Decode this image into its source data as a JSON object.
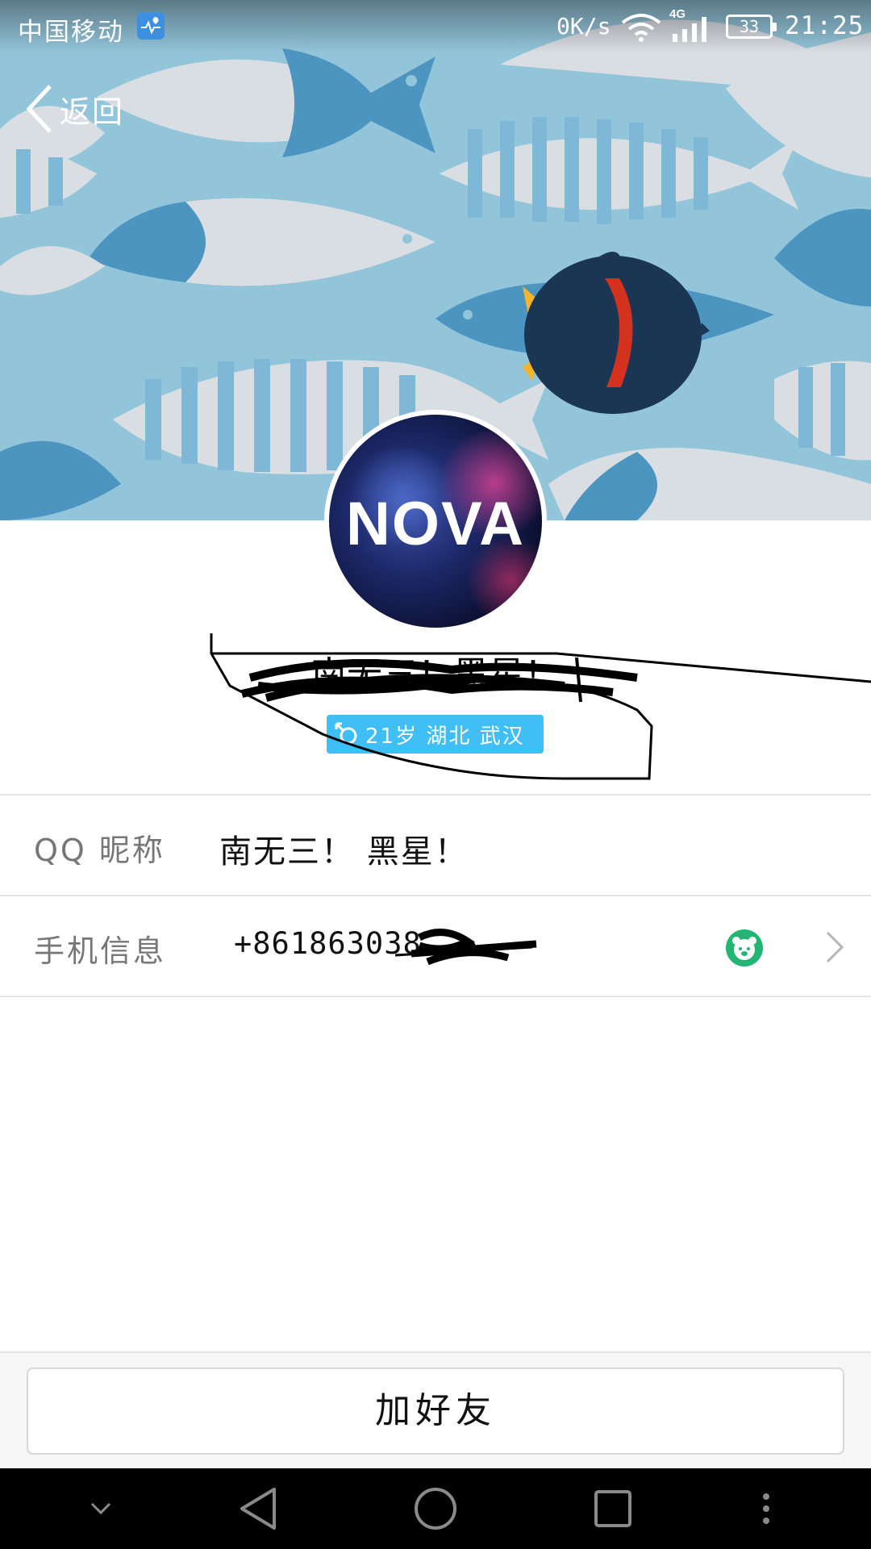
{
  "status_bar": {
    "carrier": "中国移动",
    "net_speed": "0K/s",
    "network_type": "4G",
    "battery": "33",
    "time": "21:25"
  },
  "header": {
    "back_label": "返回"
  },
  "profile": {
    "avatar_text": "NOVA",
    "nickname_heading": "南无三！黑星！",
    "info_tag": "21岁  湖北 武汉"
  },
  "details": {
    "rows": [
      {
        "label": "QQ 昵称",
        "value": "南无三！ 黑星！"
      },
      {
        "label": "手机信息",
        "value": "+861863038"
      }
    ]
  },
  "actions": {
    "add_friend_label": "加好友"
  },
  "colors": {
    "cover_bg": "#93c5da",
    "tag_bg": "#3fbff5",
    "badge_green": "#22b573"
  },
  "icons": [
    "back-chevron-icon",
    "health-app-icon",
    "wifi-icon",
    "signal-icon",
    "battery-icon",
    "gender-male-icon",
    "qq-badge-icon",
    "chevron-right-icon",
    "nav-down-icon",
    "nav-back-icon",
    "nav-home-icon",
    "nav-recents-icon",
    "nav-more-icon"
  ]
}
